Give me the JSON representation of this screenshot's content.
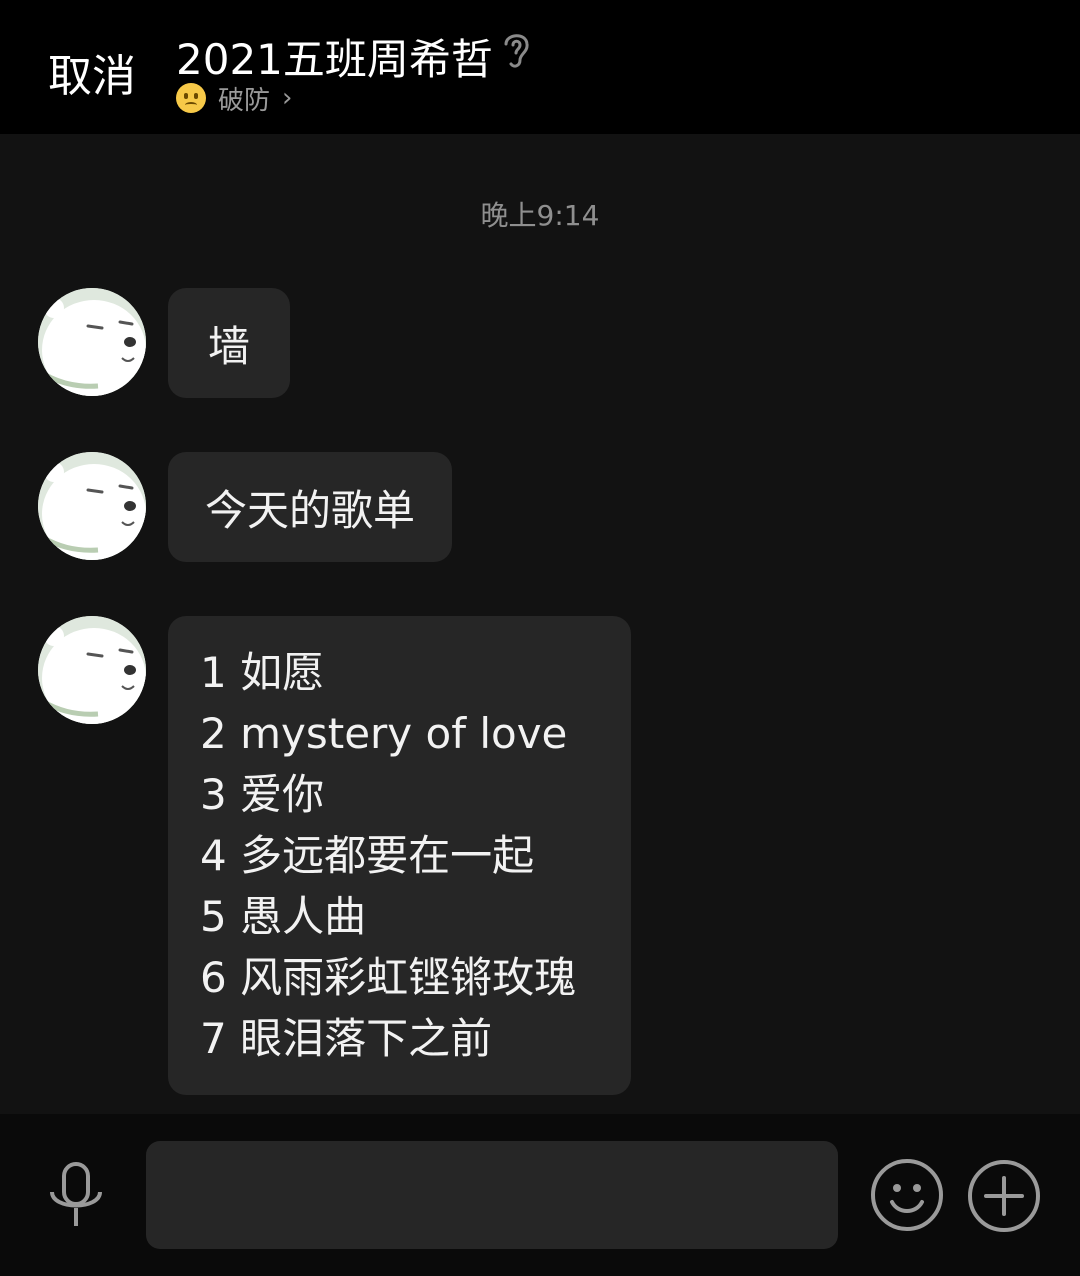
{
  "header": {
    "cancel_label": "取消",
    "title": "2021五班周希哲",
    "status_text": "破防",
    "status_icon": "frowning-face-emoji"
  },
  "chat": {
    "timestamp": "晚上9:14",
    "messages": [
      {
        "text": "墙"
      },
      {
        "text": "今天的歌单"
      },
      {
        "lines": [
          "1 如愿",
          "2 mystery of love",
          "3 爱你",
          "4 多远都要在一起",
          "5 愚人曲",
          "6 风雨彩虹铿锵玫瑰",
          "7 眼泪落下之前"
        ]
      }
    ]
  },
  "input_bar": {
    "message_value": "",
    "icons": [
      "microphone-icon",
      "emoji-icon",
      "plus-icon"
    ]
  },
  "colors": {
    "background": "#121212",
    "header": "#000000",
    "bubble": "#262626",
    "muted_text": "#8f8f8f"
  }
}
